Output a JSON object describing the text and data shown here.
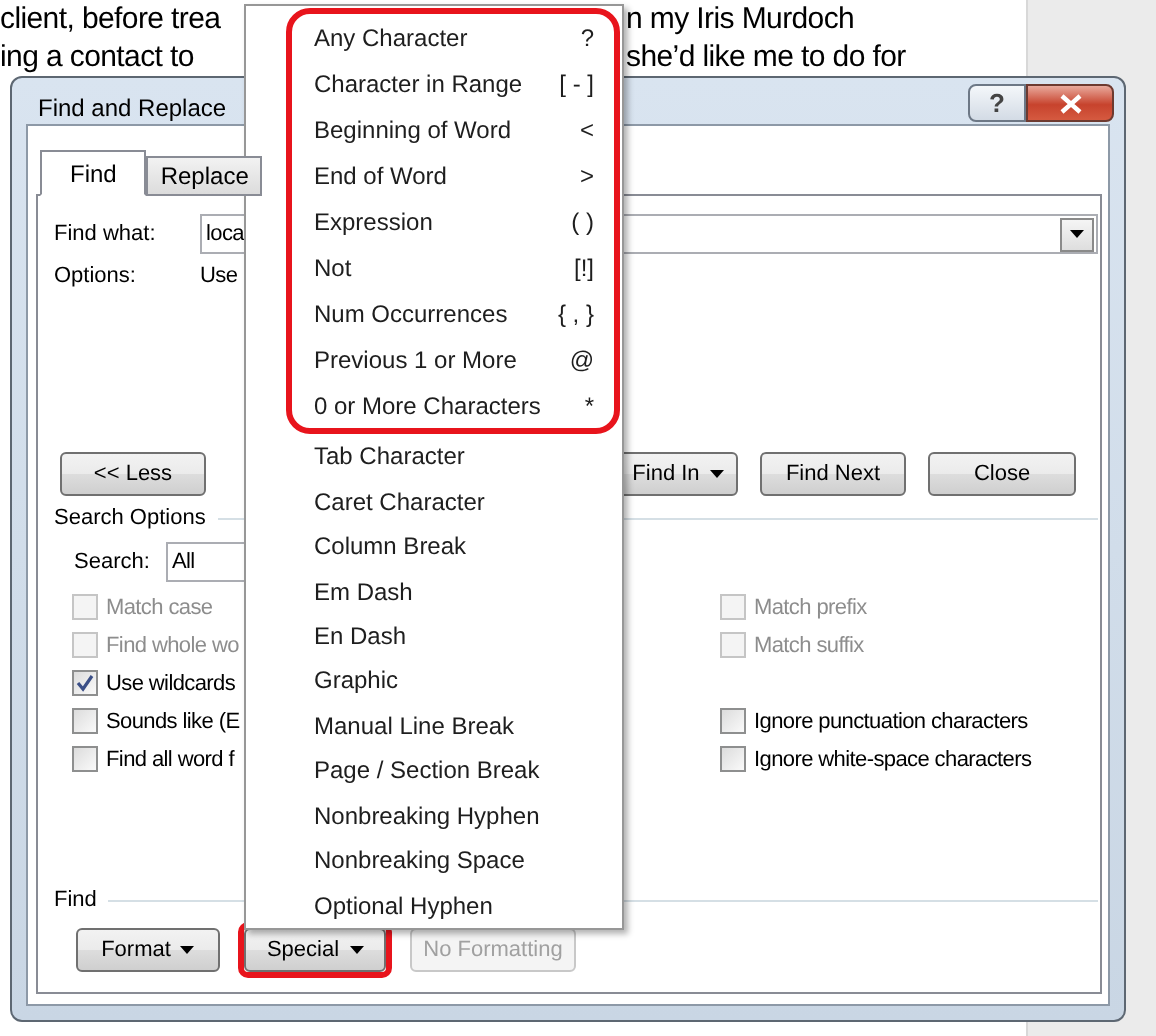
{
  "document": {
    "lines": [
      {
        "left": "client, before trea",
        "right": "n my Iris Murdoch"
      },
      {
        "left": "ing a contact to",
        "right": "she’d like me to do for"
      }
    ]
  },
  "dialog": {
    "title": "Find and Replace",
    "help": "?",
    "tabs": [
      {
        "label": "Find",
        "selected": true
      },
      {
        "label": "Replace",
        "selected": false
      }
    ],
    "find_what": {
      "label": "Find what:",
      "value": "loca"
    },
    "options": {
      "label": "Options:",
      "value": "Use"
    },
    "buttons": [
      {
        "label": "<< Less",
        "kind": "plain"
      },
      {
        "label": "Find In",
        "kind": "dropdown"
      },
      {
        "label": "Find Next",
        "kind": "plain"
      },
      {
        "label": "Close",
        "kind": "plain"
      }
    ],
    "search_options": {
      "title": "Search Options",
      "search_label": "Search:",
      "search_value": "All"
    },
    "checkboxes_left": [
      {
        "label": "Match case",
        "checked": false,
        "disabled": true
      },
      {
        "label": "Find whole wo",
        "checked": false,
        "disabled": true
      },
      {
        "label": "Use wildcards",
        "checked": true,
        "disabled": false
      },
      {
        "label": "Sounds like (E",
        "checked": false,
        "disabled": false
      },
      {
        "label": "Find all word f",
        "checked": false,
        "disabled": false
      }
    ],
    "checkboxes_right_top": [
      {
        "label": "Match prefix",
        "checked": false,
        "disabled": true
      },
      {
        "label": "Match suffix",
        "checked": false,
        "disabled": true
      }
    ],
    "checkboxes_right_bottom": [
      {
        "label": "Ignore punctuation characters",
        "checked": false,
        "disabled": false
      },
      {
        "label": "Ignore white-space characters",
        "checked": false,
        "disabled": false
      }
    ],
    "find_section": {
      "title": "Find",
      "buttons": [
        {
          "label": "Format",
          "kind": "dropdown",
          "disabled": false,
          "highlighted": false
        },
        {
          "label": "Special",
          "kind": "dropdown",
          "disabled": false,
          "highlighted": true
        },
        {
          "label": "No Formatting",
          "kind": "plain",
          "disabled": true,
          "highlighted": false
        }
      ]
    }
  },
  "menu": {
    "items": [
      {
        "label": "Any Character",
        "shortcut": "?",
        "annotated": true
      },
      {
        "label": "Character in Range",
        "shortcut": "[ - ]",
        "annotated": true
      },
      {
        "label": "Beginning of Word",
        "shortcut": "<",
        "annotated": true
      },
      {
        "label": "End of Word",
        "shortcut": ">",
        "annotated": true
      },
      {
        "label": "Expression",
        "shortcut": "( )",
        "annotated": true
      },
      {
        "label": "Not",
        "shortcut": "[!]",
        "annotated": true
      },
      {
        "label": "Num Occurrences",
        "shortcut": "{ , }",
        "annotated": true
      },
      {
        "label": "Previous 1 or More",
        "shortcut": "@",
        "annotated": true
      },
      {
        "label": "0 or More Characters",
        "shortcut": "*",
        "annotated": true
      },
      {
        "label": "Tab Character",
        "annotated": false
      },
      {
        "label": "Caret Character",
        "annotated": false
      },
      {
        "label": "Column Break",
        "annotated": false
      },
      {
        "label": "Em Dash",
        "annotated": false
      },
      {
        "label": "En Dash",
        "annotated": false
      },
      {
        "label": "Graphic",
        "annotated": false
      },
      {
        "label": "Manual Line Break",
        "annotated": false
      },
      {
        "label": "Page / Section Break",
        "annotated": false
      },
      {
        "label": "Nonbreaking Hyphen",
        "annotated": false
      },
      {
        "label": "Nonbreaking Space",
        "annotated": false
      },
      {
        "label": "Optional Hyphen",
        "annotated": false
      }
    ]
  }
}
